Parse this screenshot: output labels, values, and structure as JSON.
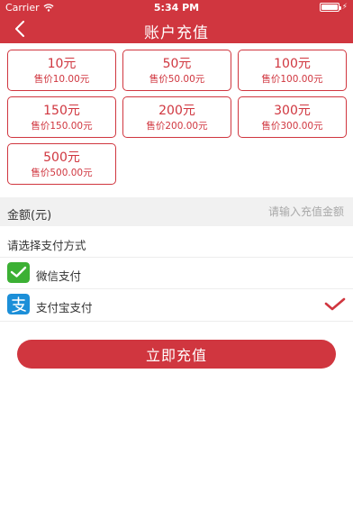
{
  "status": {
    "carrier": "Carrier",
    "time": "5:34 PM"
  },
  "nav": {
    "title": "账户充值"
  },
  "options": [
    {
      "amount": "10元",
      "price": "售价10.00元"
    },
    {
      "amount": "50元",
      "price": "售价50.00元"
    },
    {
      "amount": "100元",
      "price": "售价100.00元"
    },
    {
      "amount": "150元",
      "price": "售价150.00元"
    },
    {
      "amount": "200元",
      "price": "售价200.00元"
    },
    {
      "amount": "300元",
      "price": "售价300.00元"
    },
    {
      "amount": "500元",
      "price": "售价500.00元"
    }
  ],
  "amount": {
    "label": "金额(元)",
    "value": "",
    "placeholder": "请输入充值金额"
  },
  "payment": {
    "title": "请选择支付方式",
    "methods": [
      {
        "label": "微信支付",
        "icon": "wechat-pay-icon",
        "selected": false
      },
      {
        "label": "支付宝支付",
        "icon": "alipay-icon",
        "selected": true
      }
    ]
  },
  "submit": {
    "label": "立即充值"
  },
  "colors": {
    "accent": "#d0363f",
    "wechat": "#3cb034",
    "alipay": "#1c8fd8"
  }
}
